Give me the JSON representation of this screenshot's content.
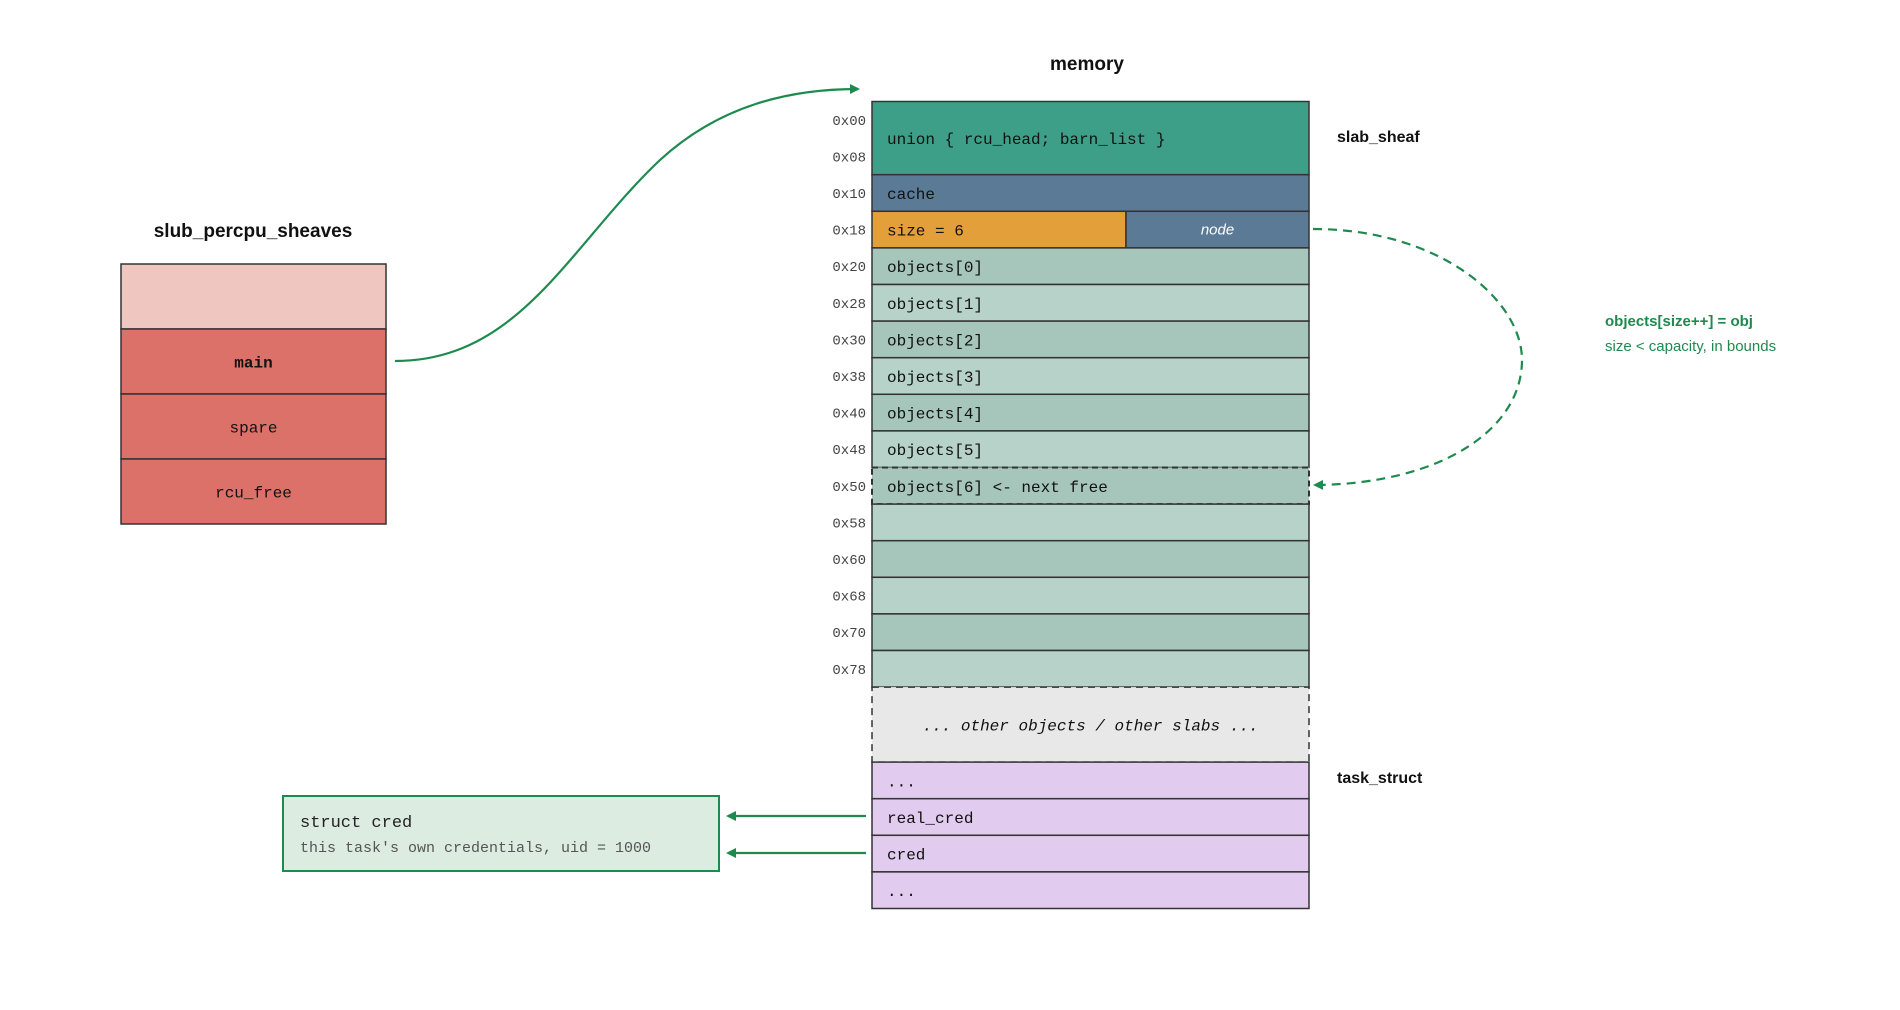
{
  "colors": {
    "sheaf_header": "#3d9f87",
    "cache": "#5b7a96",
    "size": "#e39f3a",
    "node": "#5b7a96",
    "object_dark": "#a6c5bb",
    "object_light": "#b7d2c9",
    "other": "#e8e8e8",
    "task": "#e1cbee",
    "percpu_top": "#f0c6c0",
    "percpu_cell": "#db7169",
    "cred_fill": "#dcece1",
    "arrow": "#1e8a4e",
    "border": "#333333"
  },
  "memory": {
    "title": "memory",
    "sheaf_header": {
      "addresses": [
        "0x00",
        "0x08"
      ],
      "text": "union { rcu_head; barn_list }"
    },
    "cache": {
      "address": "0x10",
      "text": "cache"
    },
    "size_row": {
      "address": "0x18",
      "size_text": "size = 6",
      "node_text": "node"
    },
    "rows": [
      {
        "address": "0x20",
        "text": "objects[0]"
      },
      {
        "address": "0x28",
        "text": "objects[1]"
      },
      {
        "address": "0x30",
        "text": "objects[2]"
      },
      {
        "address": "0x38",
        "text": "objects[3]"
      },
      {
        "address": "0x40",
        "text": "objects[4]"
      },
      {
        "address": "0x48",
        "text": "objects[5]"
      },
      {
        "address": "0x50",
        "text": "objects[6] <- next free"
      },
      {
        "address": "0x58",
        "text": ""
      },
      {
        "address": "0x60",
        "text": ""
      },
      {
        "address": "0x68",
        "text": ""
      },
      {
        "address": "0x70",
        "text": ""
      },
      {
        "address": "0x78",
        "text": ""
      }
    ],
    "other_text": "... other objects / other slabs ...",
    "task_rows": [
      "...",
      "real_cred",
      "cred",
      "..."
    ]
  },
  "labels": {
    "slab_sheaf": "slab_sheaf",
    "task_struct": "task_struct"
  },
  "percpu": {
    "title": "slub_percpu_sheaves",
    "cells": [
      "",
      "main",
      "spare",
      "rcu_free"
    ]
  },
  "note": {
    "line1": "objects[size++] = obj",
    "line2": "size < capacity, in bounds"
  },
  "cred": {
    "title": "struct cred",
    "subtitle": "this task's own credentials, uid = 1000"
  }
}
